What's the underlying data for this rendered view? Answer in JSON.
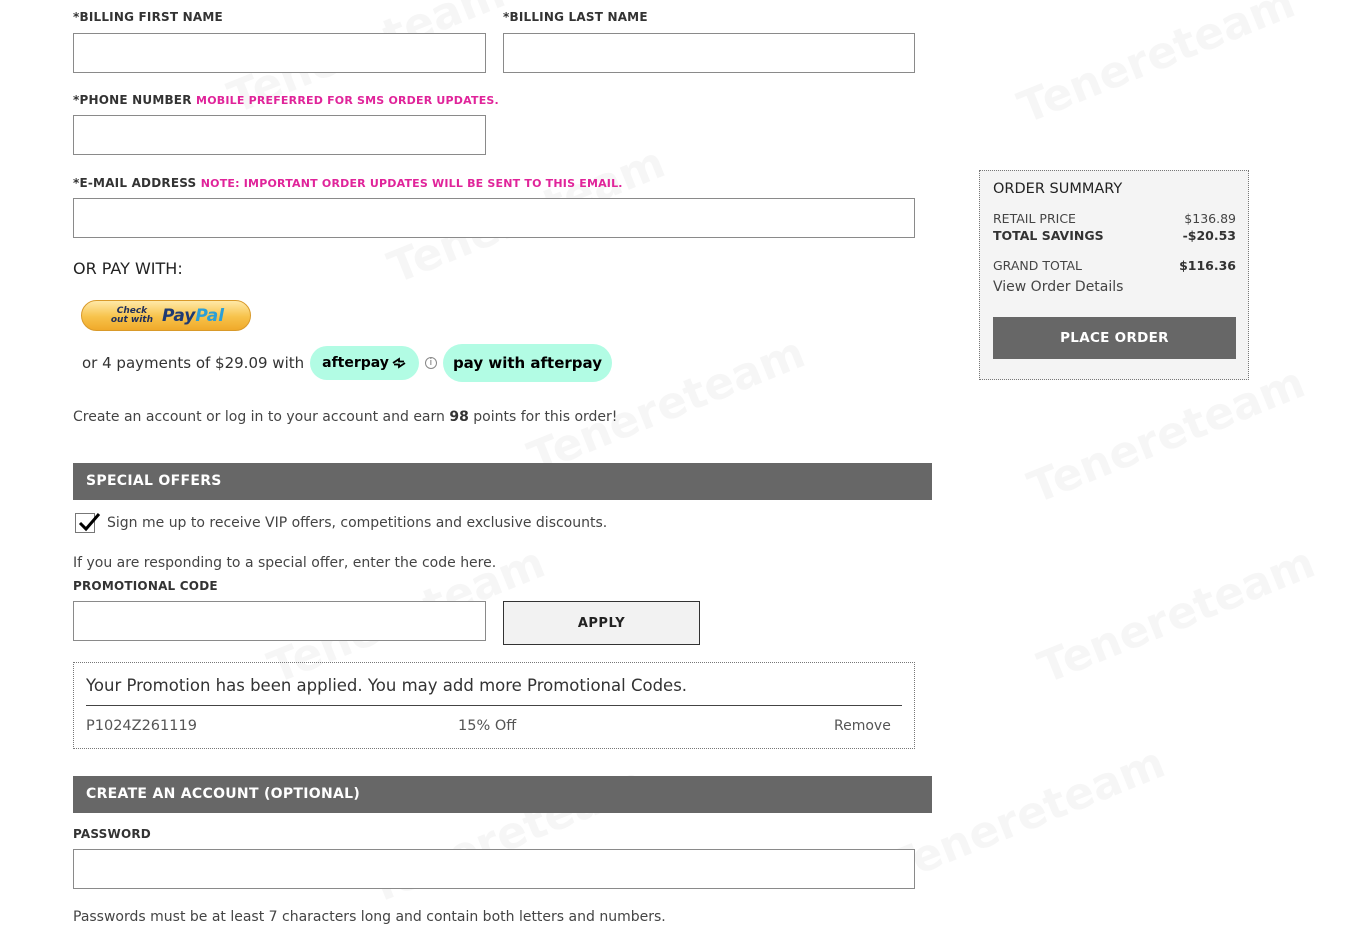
{
  "billing": {
    "first_name_label": "*BILLING FIRST NAME",
    "first_name_value": "",
    "last_name_label": "*BILLING LAST NAME",
    "last_name_value": "",
    "phone_label": "*PHONE NUMBER",
    "phone_hint": "MOBILE PREFERRED FOR SMS ORDER UPDATES.",
    "phone_value": "",
    "email_label": "*E-MAIL ADDRESS",
    "email_hint": "NOTE: IMPORTANT ORDER UPDATES WILL BE SENT TO THIS EMAIL.",
    "email_value": ""
  },
  "payment": {
    "or_pay_with": "OR PAY WITH:",
    "paypal_checkout_text": "Check out with",
    "paypal_brand_1": "Pay",
    "paypal_brand_2": "Pal",
    "afterpay_text": "or 4 payments of $29.09 with",
    "afterpay_badge": "afterpay",
    "afterpay_info": "i",
    "afterpay_button": "pay with afterpay"
  },
  "points": {
    "text_before": "Create an account or log in to your account and earn ",
    "points_value": "98",
    "text_after": " points for this order!"
  },
  "special_offers": {
    "title": "SPECIAL OFFERS",
    "vip_checked": true,
    "vip_label": "Sign me up to receive VIP offers, competitions and exclusive discounts.",
    "responding_text": "If you are responding to a special offer, enter the code here.",
    "promo_label": "PROMOTIONAL CODE",
    "promo_value": "",
    "apply_label": "APPLY",
    "applied_message": "Your Promotion has been applied. You may add more Promotional Codes.",
    "applied_code": "P1024Z261119",
    "applied_discount": "15% Off",
    "remove_label": "Remove"
  },
  "account": {
    "title": "CREATE AN ACCOUNT (OPTIONAL)",
    "password_label": "PASSWORD",
    "password_value": "",
    "password_hint": "Passwords must be at least 7 characters long and contain both letters and numbers."
  },
  "order_summary": {
    "title": "ORDER SUMMARY",
    "retail_label": "RETAIL PRICE",
    "retail_value": "$136.89",
    "savings_label": "TOTAL SAVINGS",
    "savings_value": "-$20.53",
    "grand_label": "GRAND TOTAL",
    "grand_value": "$116.36",
    "details_link": "View Order Details",
    "place_order_label": "PLACE ORDER"
  },
  "watermark_text": "Tenereteam",
  "colors": {
    "accent_pink": "#e0249a",
    "section_bar": "#676767",
    "afterpay_mint": "#b2fce4"
  }
}
